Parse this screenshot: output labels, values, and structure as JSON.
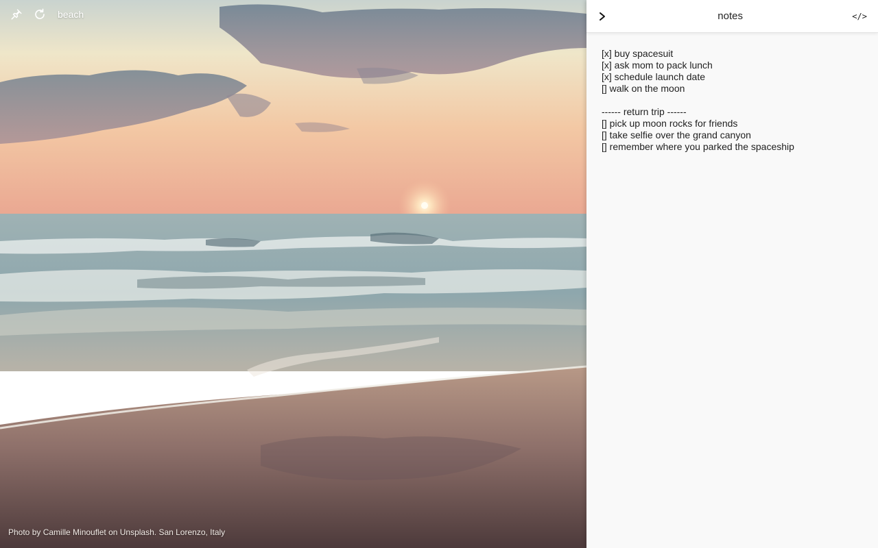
{
  "background": {
    "title": "beach",
    "credit": "Photo by Camille Minouflet on Unsplash. San Lorenzo, Italy",
    "icons": [
      "pin-icon",
      "refresh-icon"
    ]
  },
  "notes_panel": {
    "title": "notes",
    "collapse_icon": "chevron-right-icon",
    "code_toggle_label": "</>",
    "lines": [
      "[x] buy spacesuit",
      "[x] ask mom to pack lunch",
      "[x] schedule launch date",
      "[] walk on the moon",
      "",
      "------ return trip ------",
      "[] pick up moon rocks for friends",
      "[] take selfie over the grand canyon",
      "[] remember where you parked the spaceship"
    ]
  }
}
